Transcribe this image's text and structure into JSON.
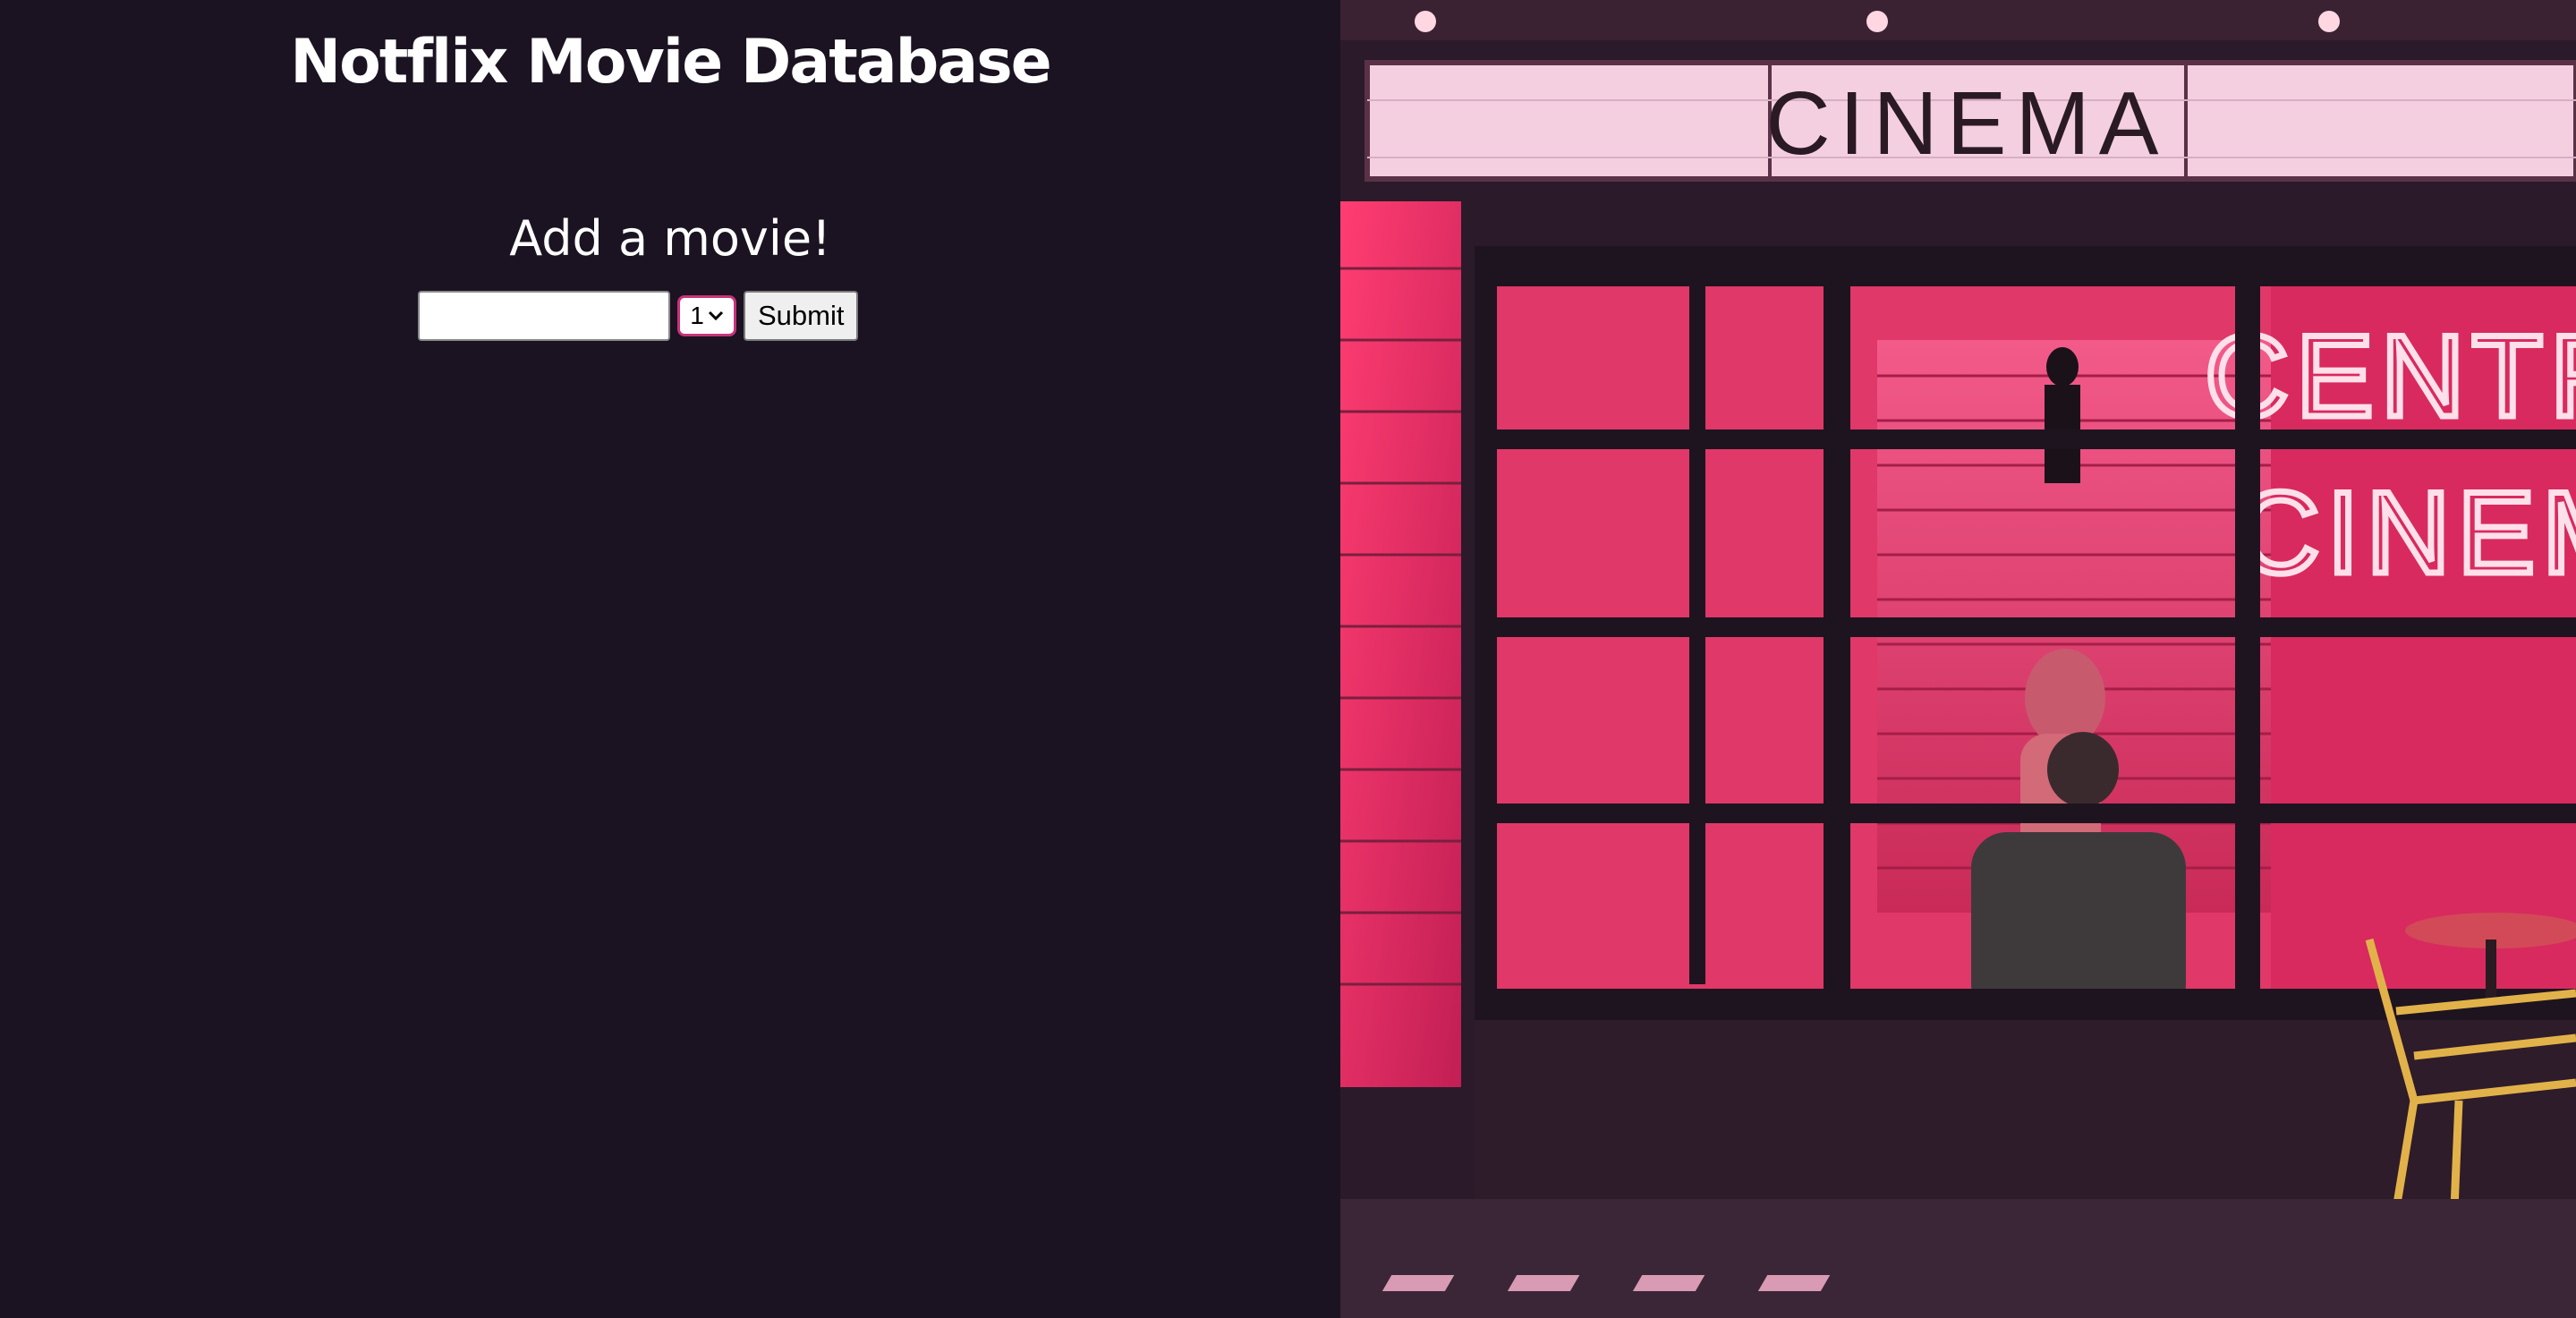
{
  "header": {
    "title": "Notflix Movie Database"
  },
  "form": {
    "heading": "Add a movie!",
    "movie_input_value": "",
    "rating_selected": "1",
    "submit_label": "Submit"
  },
  "photo": {
    "marquee_text": "CINEMA",
    "neon_line1": "CENTR",
    "neon_line2": "CINEM"
  }
}
